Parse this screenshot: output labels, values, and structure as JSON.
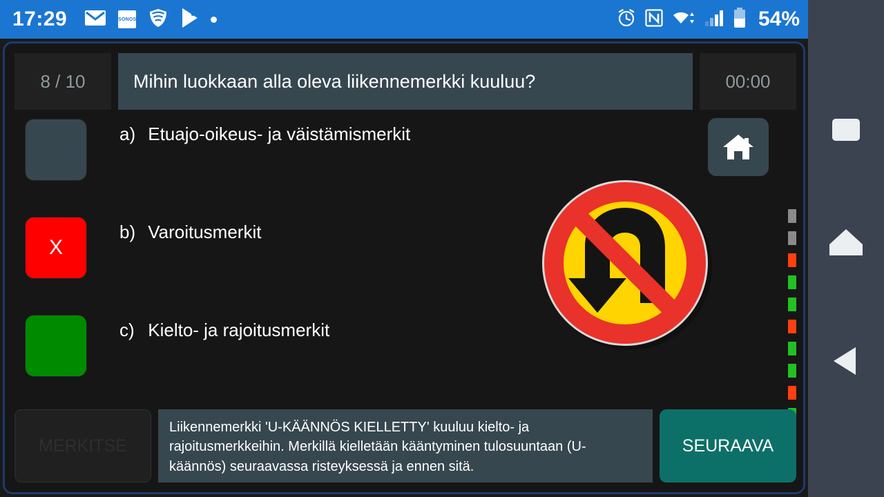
{
  "statusbar": {
    "clock": "17:29",
    "battery_percent": "54%",
    "left_icons": [
      "mail-icon",
      "sonos-icon",
      "wifi-shield-icon",
      "play-store-icon",
      "dot-icon"
    ],
    "right_icons": [
      "alarm-icon",
      "nfc-icon",
      "wifi-icon",
      "cellular-signal-icon",
      "battery-icon"
    ],
    "sonos_label": "SONOS",
    "accent_color": "#1b76d2"
  },
  "navbar": {
    "recents_label": "recents",
    "home_label": "home",
    "back_label": "back",
    "background": "#3c4350"
  },
  "quiz": {
    "counter": "8 / 10",
    "question": "Mihin luokkaan alla oleva liikennemerkki kuuluu?",
    "timer": "00:00",
    "header_color": "#37474f",
    "options": [
      {
        "letter": "a)",
        "text": "Etuajo-oikeus- ja väistämismerkit",
        "state": "unselected",
        "marker": "",
        "color": "#37474f"
      },
      {
        "letter": "b)",
        "text": "Varoitusmerkit",
        "state": "wrong",
        "marker": "X",
        "color": "#ff0000"
      },
      {
        "letter": "c)",
        "text": "Kielto- ja rajoitusmerkit",
        "state": "correct",
        "marker": "",
        "color": "#008a00"
      }
    ],
    "home_button": "home-icon",
    "sign": {
      "name": "no-u-turn-sign",
      "alt": "U-KÄÄNNÖS KIELLETTY",
      "ring_color": "#e8322a",
      "face_color": "#ffd400",
      "arrow_color": "#1a1a1a"
    },
    "progress": [
      {
        "index": 1,
        "status": "gray",
        "color": "#8a8a8a"
      },
      {
        "index": 2,
        "status": "gray",
        "color": "#8a8a8a"
      },
      {
        "index": 3,
        "status": "wrong",
        "color": "#ff4010"
      },
      {
        "index": 4,
        "status": "right",
        "color": "#23c023"
      },
      {
        "index": 5,
        "status": "right",
        "color": "#23c023"
      },
      {
        "index": 6,
        "status": "wrong",
        "color": "#ff4010"
      },
      {
        "index": 7,
        "status": "right",
        "color": "#23c023"
      },
      {
        "index": 8,
        "status": "right",
        "color": "#23c023"
      },
      {
        "index": 9,
        "status": "wrong",
        "color": "#ff4010"
      },
      {
        "index": 10,
        "status": "right",
        "color": "#23c023"
      }
    ],
    "explanation": "Liikennemerkki 'U-KÄÄNNÖS KIELLETTY' kuuluu kielto- ja rajoitusmerkkeihin. Merkillä kielletään kääntyminen tulosuuntaan (U-käännös) seuraavassa risteyksessä ja ennen sitä.",
    "mark_button": "MERKITSE",
    "next_button": "SEURAAVA",
    "next_button_color": "#0d7068"
  }
}
